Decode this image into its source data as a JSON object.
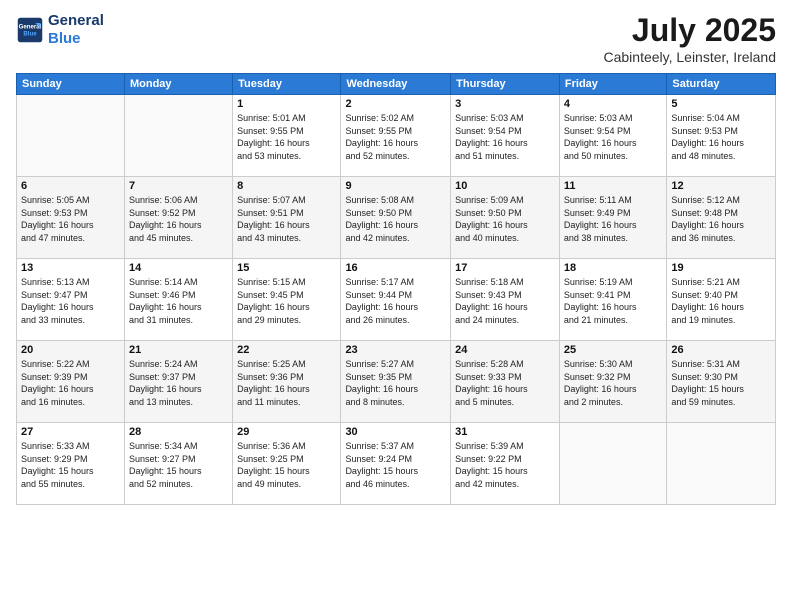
{
  "header": {
    "logo_line1": "General",
    "logo_line2": "Blue",
    "title": "July 2025",
    "location": "Cabinteely, Leinster, Ireland"
  },
  "days_of_week": [
    "Sunday",
    "Monday",
    "Tuesday",
    "Wednesday",
    "Thursday",
    "Friday",
    "Saturday"
  ],
  "weeks": [
    [
      {
        "day": "",
        "info": ""
      },
      {
        "day": "",
        "info": ""
      },
      {
        "day": "1",
        "info": "Sunrise: 5:01 AM\nSunset: 9:55 PM\nDaylight: 16 hours\nand 53 minutes."
      },
      {
        "day": "2",
        "info": "Sunrise: 5:02 AM\nSunset: 9:55 PM\nDaylight: 16 hours\nand 52 minutes."
      },
      {
        "day": "3",
        "info": "Sunrise: 5:03 AM\nSunset: 9:54 PM\nDaylight: 16 hours\nand 51 minutes."
      },
      {
        "day": "4",
        "info": "Sunrise: 5:03 AM\nSunset: 9:54 PM\nDaylight: 16 hours\nand 50 minutes."
      },
      {
        "day": "5",
        "info": "Sunrise: 5:04 AM\nSunset: 9:53 PM\nDaylight: 16 hours\nand 48 minutes."
      }
    ],
    [
      {
        "day": "6",
        "info": "Sunrise: 5:05 AM\nSunset: 9:53 PM\nDaylight: 16 hours\nand 47 minutes."
      },
      {
        "day": "7",
        "info": "Sunrise: 5:06 AM\nSunset: 9:52 PM\nDaylight: 16 hours\nand 45 minutes."
      },
      {
        "day": "8",
        "info": "Sunrise: 5:07 AM\nSunset: 9:51 PM\nDaylight: 16 hours\nand 43 minutes."
      },
      {
        "day": "9",
        "info": "Sunrise: 5:08 AM\nSunset: 9:50 PM\nDaylight: 16 hours\nand 42 minutes."
      },
      {
        "day": "10",
        "info": "Sunrise: 5:09 AM\nSunset: 9:50 PM\nDaylight: 16 hours\nand 40 minutes."
      },
      {
        "day": "11",
        "info": "Sunrise: 5:11 AM\nSunset: 9:49 PM\nDaylight: 16 hours\nand 38 minutes."
      },
      {
        "day": "12",
        "info": "Sunrise: 5:12 AM\nSunset: 9:48 PM\nDaylight: 16 hours\nand 36 minutes."
      }
    ],
    [
      {
        "day": "13",
        "info": "Sunrise: 5:13 AM\nSunset: 9:47 PM\nDaylight: 16 hours\nand 33 minutes."
      },
      {
        "day": "14",
        "info": "Sunrise: 5:14 AM\nSunset: 9:46 PM\nDaylight: 16 hours\nand 31 minutes."
      },
      {
        "day": "15",
        "info": "Sunrise: 5:15 AM\nSunset: 9:45 PM\nDaylight: 16 hours\nand 29 minutes."
      },
      {
        "day": "16",
        "info": "Sunrise: 5:17 AM\nSunset: 9:44 PM\nDaylight: 16 hours\nand 26 minutes."
      },
      {
        "day": "17",
        "info": "Sunrise: 5:18 AM\nSunset: 9:43 PM\nDaylight: 16 hours\nand 24 minutes."
      },
      {
        "day": "18",
        "info": "Sunrise: 5:19 AM\nSunset: 9:41 PM\nDaylight: 16 hours\nand 21 minutes."
      },
      {
        "day": "19",
        "info": "Sunrise: 5:21 AM\nSunset: 9:40 PM\nDaylight: 16 hours\nand 19 minutes."
      }
    ],
    [
      {
        "day": "20",
        "info": "Sunrise: 5:22 AM\nSunset: 9:39 PM\nDaylight: 16 hours\nand 16 minutes."
      },
      {
        "day": "21",
        "info": "Sunrise: 5:24 AM\nSunset: 9:37 PM\nDaylight: 16 hours\nand 13 minutes."
      },
      {
        "day": "22",
        "info": "Sunrise: 5:25 AM\nSunset: 9:36 PM\nDaylight: 16 hours\nand 11 minutes."
      },
      {
        "day": "23",
        "info": "Sunrise: 5:27 AM\nSunset: 9:35 PM\nDaylight: 16 hours\nand 8 minutes."
      },
      {
        "day": "24",
        "info": "Sunrise: 5:28 AM\nSunset: 9:33 PM\nDaylight: 16 hours\nand 5 minutes."
      },
      {
        "day": "25",
        "info": "Sunrise: 5:30 AM\nSunset: 9:32 PM\nDaylight: 16 hours\nand 2 minutes."
      },
      {
        "day": "26",
        "info": "Sunrise: 5:31 AM\nSunset: 9:30 PM\nDaylight: 15 hours\nand 59 minutes."
      }
    ],
    [
      {
        "day": "27",
        "info": "Sunrise: 5:33 AM\nSunset: 9:29 PM\nDaylight: 15 hours\nand 55 minutes."
      },
      {
        "day": "28",
        "info": "Sunrise: 5:34 AM\nSunset: 9:27 PM\nDaylight: 15 hours\nand 52 minutes."
      },
      {
        "day": "29",
        "info": "Sunrise: 5:36 AM\nSunset: 9:25 PM\nDaylight: 15 hours\nand 49 minutes."
      },
      {
        "day": "30",
        "info": "Sunrise: 5:37 AM\nSunset: 9:24 PM\nDaylight: 15 hours\nand 46 minutes."
      },
      {
        "day": "31",
        "info": "Sunrise: 5:39 AM\nSunset: 9:22 PM\nDaylight: 15 hours\nand 42 minutes."
      },
      {
        "day": "",
        "info": ""
      },
      {
        "day": "",
        "info": ""
      }
    ]
  ]
}
